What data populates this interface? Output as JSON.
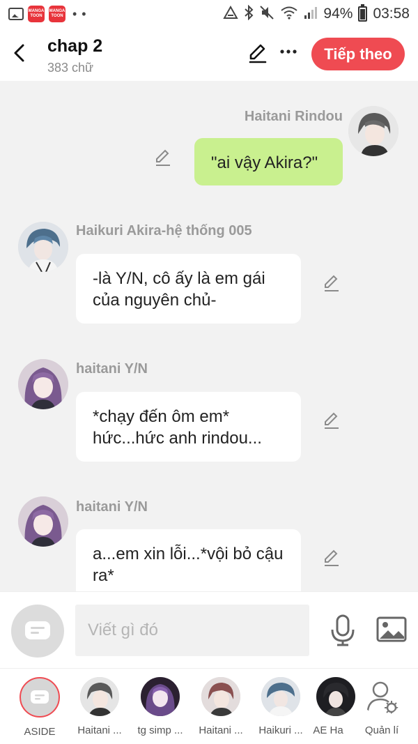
{
  "status_bar": {
    "app_badge_1": "MANGA TOON",
    "app_badge_2": "MANGA TOON",
    "dots": "• •",
    "battery": "94%",
    "time": "03:58"
  },
  "header": {
    "title": "chap 2",
    "subtitle": "383 chữ",
    "next_label": "Tiếp theo"
  },
  "messages": [
    {
      "sender": "Haitani Rindou",
      "text": "\"ai vậy Akira?\"",
      "side": "right",
      "avatar": "boy-gray-hair"
    },
    {
      "sender": "Haikuri Akira-hệ thống 005",
      "text": "-là Y/N, cô ấy là em gái của nguyên chủ-",
      "side": "left",
      "avatar": "boy-blue-hair"
    },
    {
      "sender": "haitani Y/N",
      "text": "*chạy đến ôm em* hức...hức anh rindou...",
      "side": "left",
      "avatar": "girl-purple-hair"
    },
    {
      "sender": "haitani Y/N",
      "text": "a...em xin lỗi...*vội bỏ cậu ra*",
      "side": "left",
      "avatar": "girl-purple-hair"
    }
  ],
  "composer": {
    "placeholder": "Viết gì đó"
  },
  "characters": [
    {
      "label": "ASIDE"
    },
    {
      "label": "Haitani ..."
    },
    {
      "label": "tg simp ..."
    },
    {
      "label": "Haitani ..."
    },
    {
      "label": "Haikuri ..."
    },
    {
      "label": "AE Ha"
    },
    {
      "label": "Quản lí"
    }
  ],
  "colors": {
    "accent": "#ef4b52",
    "my_bubble": "#c9f08f",
    "other_bubble": "#ffffff",
    "background": "#f2f2f2"
  }
}
